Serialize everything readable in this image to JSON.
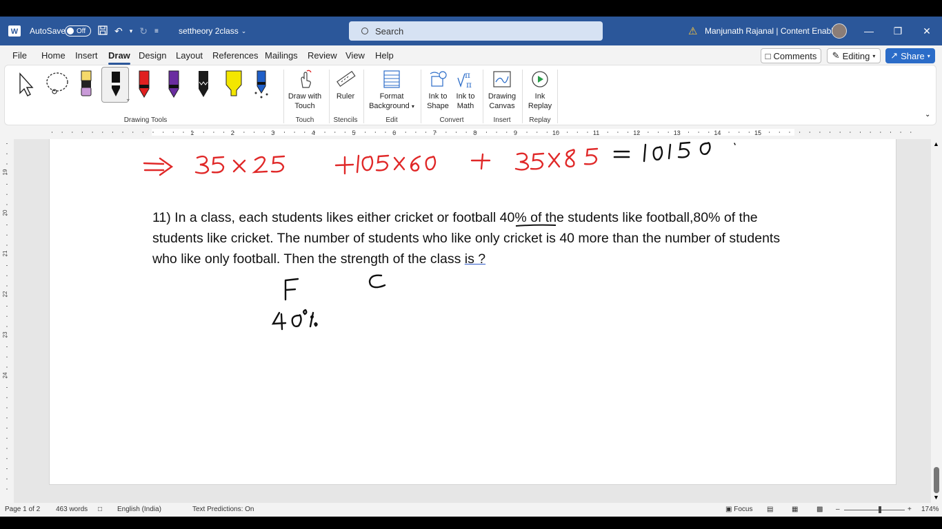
{
  "titlebar": {
    "autosave_label": "AutoSave",
    "autosave_state": "Off",
    "document_title": "settheory 2class",
    "search_placeholder": "Search",
    "user_name": "Manjunath Rajanal | Content Enablers"
  },
  "menu": {
    "tabs": [
      "File",
      "Home",
      "Insert",
      "Draw",
      "Design",
      "Layout",
      "References",
      "Mailings",
      "Review",
      "View",
      "Help"
    ],
    "active_tab": "Draw",
    "comments_label": "Comments",
    "editing_label": "Editing",
    "share_label": "Share"
  },
  "ribbon": {
    "groups": {
      "drawing_tools": "Drawing Tools",
      "touch": "Touch",
      "stencils": "Stencils",
      "edit": "Edit",
      "convert": "Convert",
      "insert": "Insert",
      "replay": "Replay"
    },
    "draw_with_touch": [
      "Draw with",
      "Touch"
    ],
    "ruler": "Ruler",
    "format_background": [
      "Format",
      "Background"
    ],
    "ink_to_shape": [
      "Ink to",
      "Shape"
    ],
    "ink_to_math": [
      "Ink to",
      "Math"
    ],
    "drawing_canvas": [
      "Drawing",
      "Canvas"
    ],
    "ink_replay": [
      "Ink",
      "Replay"
    ],
    "pen_colors": [
      "#e8e04a",
      "#1a1a1a",
      "#e02020",
      "#6a2da0",
      "#1a1a1a",
      "#f3e600",
      "#1f5fc8"
    ]
  },
  "ruler": {
    "h_numbers": [
      "1",
      "2",
      "3",
      "4",
      "5",
      "6",
      "7",
      "8",
      "9",
      "10",
      "11",
      "12",
      "13",
      "14",
      "15"
    ],
    "v_numbers": [
      "19",
      "20",
      "21",
      "22",
      "23",
      "24"
    ]
  },
  "document": {
    "question_parts": [
      "11) In a class, each students likes either cricket or football ",
      "40% ",
      "of the students like football,80% of the students like cricket. The number of students who like only cricket is 40 more than the number of students who like only football. Then the strength of the class ",
      "is ?"
    ],
    "ink": {
      "arrow": "=>",
      "red_expression_1": "35 X 25",
      "red_expression_2": "+105X 60",
      "red_plus": "+",
      "red_expression_3": "35X 85",
      "equals": "=",
      "result": "10150",
      "label_f": "F",
      "label_c": "C",
      "percent_40": "40%"
    },
    "colors": {
      "ink_red": "#e02828",
      "ink_black": "#111111"
    }
  },
  "status": {
    "page": "Page 1 of 2",
    "words": "463 words",
    "language": "English (India)",
    "predictions": "Text Predictions: On",
    "focus": "Focus",
    "zoom": "174%"
  }
}
